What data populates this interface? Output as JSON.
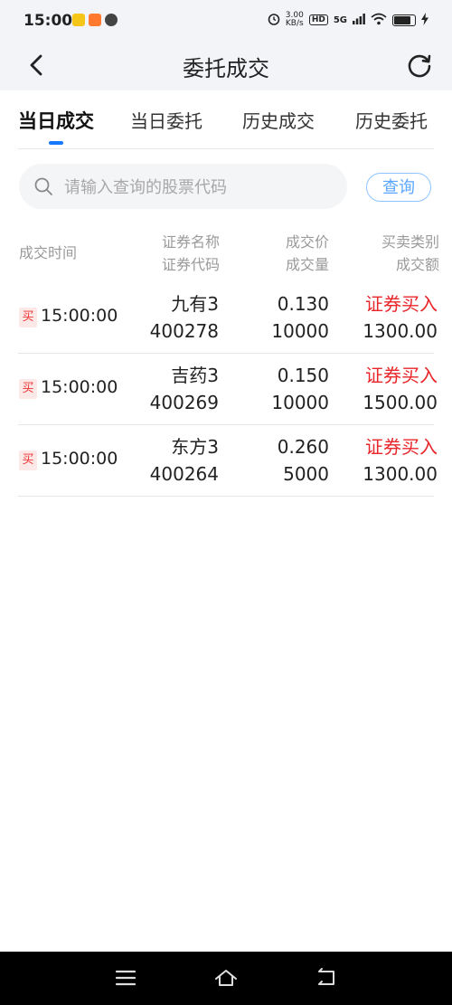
{
  "status_bar": {
    "time": "15:00",
    "net_speed": "3.00",
    "net_unit": "KB/s",
    "hd": "HD",
    "signal": "5G"
  },
  "header": {
    "title": "委托成交"
  },
  "tabs": [
    {
      "label": "当日成交",
      "active": true
    },
    {
      "label": "当日委托",
      "active": false
    },
    {
      "label": "历史成交",
      "active": false
    },
    {
      "label": "历史委托",
      "active": false
    }
  ],
  "search": {
    "placeholder": "请输入查询的股票代码",
    "value": "",
    "button_label": "查询"
  },
  "columns": {
    "time": "成交时间",
    "name": "证券名称",
    "code": "证券代码",
    "price": "成交价",
    "volume": "成交量",
    "type": "买卖类别",
    "amount": "成交额"
  },
  "rows": [
    {
      "badge": "买",
      "time": "15:00:00",
      "name": "九有3",
      "code": "400278",
      "price": "0.130",
      "volume": "10000",
      "type": "证券买入",
      "amount": "1300.00"
    },
    {
      "badge": "买",
      "time": "15:00:00",
      "name": "吉药3",
      "code": "400269",
      "price": "0.150",
      "volume": "10000",
      "type": "证券买入",
      "amount": "1500.00"
    },
    {
      "badge": "买",
      "time": "15:00:00",
      "name": "东方3",
      "code": "400264",
      "price": "0.260",
      "volume": "5000",
      "type": "证券买入",
      "amount": "1300.00"
    }
  ],
  "colors": {
    "accent": "#1677ff",
    "buy": "#e8262a"
  },
  "icons": {
    "back": "chevron-left-icon",
    "refresh": "refresh-icon",
    "search": "search-icon",
    "nav_menu": "menu-icon",
    "nav_home": "home-icon",
    "nav_back": "back-icon"
  }
}
